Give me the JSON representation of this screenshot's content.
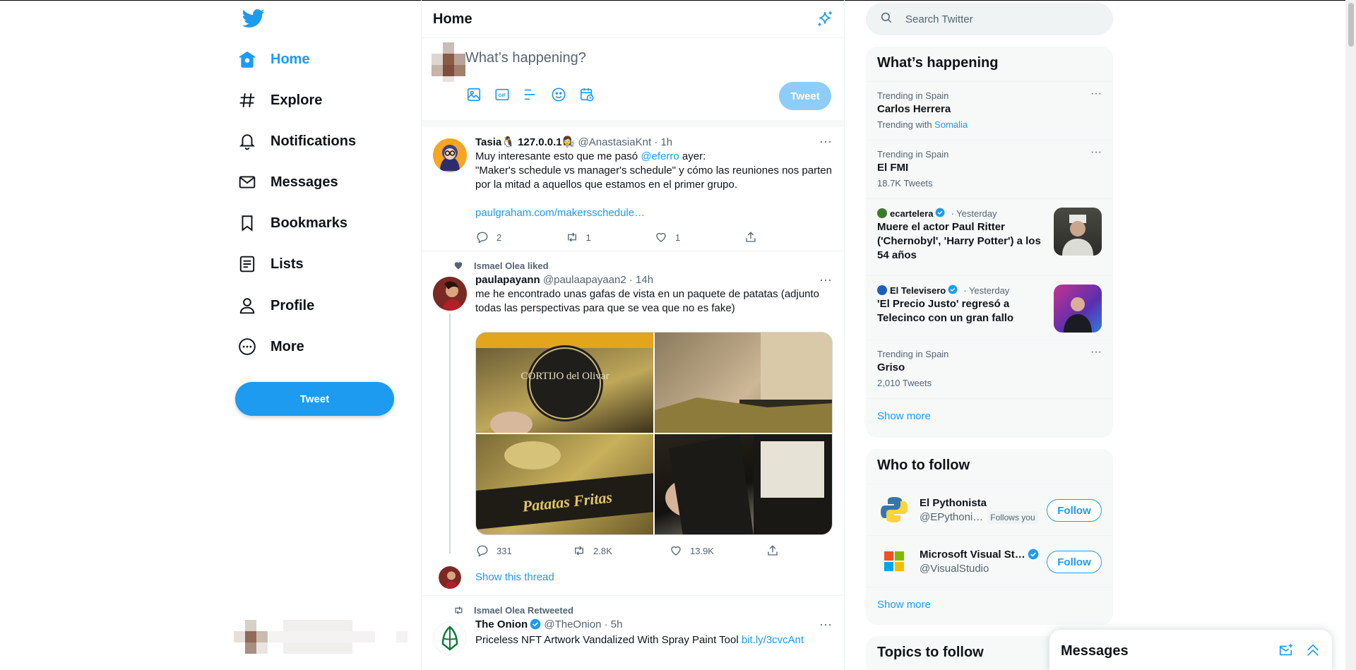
{
  "colors": {
    "brand": "#1d9bf0",
    "text": "#0f1419",
    "muted": "#536471",
    "border": "#eff3f4"
  },
  "nav": {
    "items": [
      {
        "label": "Home",
        "icon": "home-icon",
        "active": true
      },
      {
        "label": "Explore",
        "icon": "hashtag-icon"
      },
      {
        "label": "Notifications",
        "icon": "bell-icon"
      },
      {
        "label": "Messages",
        "icon": "envelope-icon"
      },
      {
        "label": "Bookmarks",
        "icon": "bookmark-icon"
      },
      {
        "label": "Lists",
        "icon": "list-icon"
      },
      {
        "label": "Profile",
        "icon": "person-icon"
      },
      {
        "label": "More",
        "icon": "more-circle-icon"
      }
    ],
    "tweet_button": "Tweet"
  },
  "header": {
    "title": "Home"
  },
  "compose": {
    "placeholder": "What’s happening?",
    "tweet_button": "Tweet"
  },
  "tweets": [
    {
      "name": "Tasia🐧 127.0.0.1👩‍🔬",
      "handle": "@AnastasiaKnt",
      "time": "· 1h",
      "text_before": "Muy interesante esto que me pasó ",
      "mention": "@eferro",
      "text_after": " ayer:",
      "text_line2": "\"Maker's schedule vs manager's schedule\" y cómo las reuniones nos parten por la mitad a aquellos que estamos en el primer grupo.",
      "link": "paulgraham.com/makersschedule…",
      "replies": "2",
      "retweets": "1",
      "likes": "1"
    },
    {
      "context": "Ismael Olea liked",
      "name": "paulapayann",
      "handle": "@paulaapayaan2",
      "time": "· 14h",
      "text": "me he encontrado unas gafas de vista en un paquete de patatas (adjunto todas las perspectivas para que se vea que no es fake)",
      "photo_captions": [
        "CORTIJO del Olivar",
        "Patatas Fritas"
      ],
      "replies": "331",
      "retweets": "2.8K",
      "likes": "13.9K",
      "show_thread": "Show this thread"
    },
    {
      "context": "Ismael Olea Retweeted",
      "name": "The Onion",
      "handle": "@TheOnion",
      "time": "· 5h",
      "text": "Priceless NFT Artwork Vandalized With Spray Paint Tool ",
      "link": "bit.ly/3cvcAnt"
    }
  ],
  "search": {
    "placeholder": "Search Twitter"
  },
  "happening": {
    "title": "What’s happening",
    "trends": [
      {
        "meta": "Trending in Spain",
        "name": "Carlos Herrera",
        "sub_prefix": "Trending with ",
        "sub_link": "Somalia"
      },
      {
        "meta": "Trending in Spain",
        "name": "El FMI",
        "sub": "18.7K Tweets"
      },
      {
        "source": "ecartelera",
        "time": "· Yesterday",
        "name": "Muere el actor Paul Ritter ('Chernobyl', 'Harry Potter') a los 54 años"
      },
      {
        "source": "El Televisero",
        "time": "· Yesterday",
        "name": "'El Precio Justo' regresó a Telecinco con un gran fallo"
      },
      {
        "meta": "Trending in Spain",
        "name": "Griso",
        "sub": "2,010 Tweets"
      }
    ],
    "show_more": "Show more"
  },
  "who_to_follow": {
    "title": "Who to follow",
    "users": [
      {
        "name": "El Pythonista",
        "handle": "@EPythoni…",
        "badge": "Follows you",
        "button": "Follow"
      },
      {
        "name": "Microsoft Visual St…",
        "handle": "@VisualStudio",
        "button": "Follow"
      }
    ],
    "show_more": "Show more"
  },
  "topics": {
    "title": "Topics to follow"
  },
  "messages_drawer": {
    "title": "Messages"
  }
}
